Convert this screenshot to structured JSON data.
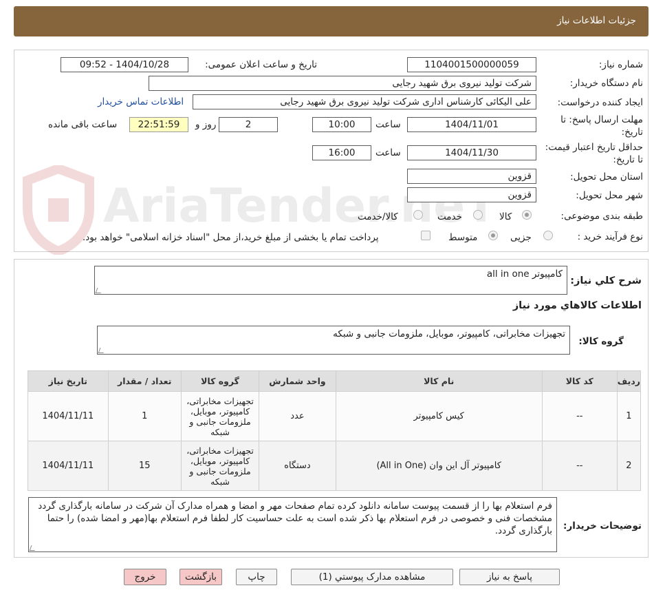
{
  "header": {
    "title": "جزئیات اطلاعات نیاز"
  },
  "watermark": {
    "text": "AriaTender.neT"
  },
  "details": {
    "need_number_label": "شماره نیاز:",
    "need_number": "1104001500000059",
    "announce_label": "تاریخ و ساعت اعلان عمومی:",
    "announce_value": "1404/10/28 - 09:52",
    "buyer_org_label": "نام دستگاه خریدار:",
    "buyer_org": "شرکت تولید نیروی برق شهید رجایی",
    "creator_label": "ایجاد کننده درخواست:",
    "creator": "علی الیکائی کارشناس اداری شرکت تولید نیروی برق شهید رجایی",
    "contact_link": "اطلاعات تماس خریدار",
    "deadline_label": "مهلت ارسال پاسخ: تا تاریخ:",
    "deadline_date": "1404/11/01",
    "time_word": "ساعت",
    "deadline_time": "10:00",
    "days_value": "2",
    "days_and": "روز و",
    "remaining_time": "22:51:59",
    "remaining_label": "ساعت باقی مانده",
    "validity_label": "حداقل تاریخ اعتبار قیمت: تا تاریخ:",
    "validity_date": "1404/11/30",
    "validity_time": "16:00",
    "province_label": "استان محل تحویل:",
    "province": "قزوین",
    "city_label": "شهر محل تحویل:",
    "city": "قزوین",
    "category_label": "طبقه بندی موضوعی:",
    "category_options": [
      "کالا",
      "خدمت",
      "کالا/خدمت"
    ],
    "process_label": "نوع فرآیند خرید :",
    "process_options": [
      "جزیی",
      "متوسط"
    ],
    "payment_note": "پرداخت تمام یا بخشی از مبلغ خرید،از محل \"اسناد خزانه اسلامی\" خواهد بود."
  },
  "summary": {
    "label": "شرح کلي نياز:",
    "value": "کامپیوتر all in one",
    "items_section_title": "اطلاعات کالاهاي مورد نياز",
    "group_label": "گروه کالا:",
    "group_value": "تجهیزات مخابراتی، کامپیوتر، موبایل، ملزومات جانبی و شبکه"
  },
  "table": {
    "headers": [
      "رديف",
      "کد کالا",
      "نام کالا",
      "واحد شمارش",
      "گروه کالا",
      "تعداد / مقدار",
      "تاریخ نیاز"
    ],
    "rows": [
      [
        "1",
        "--",
        "کیس کامپیوتر",
        "عدد",
        "تجهیزات مخابراتی، کامپیوتر، موبایل، ملزومات جانبی و شبکه",
        "1",
        "1404/11/11"
      ],
      [
        "2",
        "--",
        "کامپیوتر آل این وان (All in One)",
        "دستگاه",
        "تجهیزات مخابراتی، کامپیوتر، موبایل، ملزومات جانبی و شبکه",
        "15",
        "1404/11/11"
      ]
    ]
  },
  "buyer_notes": {
    "label": "توضیحات خریدار:",
    "value": "فرم استعلام بها را از قسمت پیوست سامانه دانلود کرده تمام صفحات مهر و امضا و همراه مدارک آن شرکت در سامانه بارگذاری گردد مشخصات فنی و خصوصی در فرم استعلام بها ذکر شده است به علت حساسیت کار لطفا  فرم استعلام بها(مهر و امضا شده)  را حتما بارگذاری گردد."
  },
  "buttons": {
    "reply": "پاسخ به نياز",
    "attachments": "مشاهده مدارک پيوستي (1)",
    "print": "چاپ",
    "back": "بازگشت",
    "exit": "خروج"
  }
}
